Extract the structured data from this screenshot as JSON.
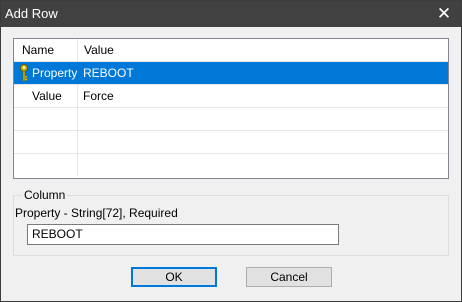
{
  "window": {
    "title": "Add Row",
    "close_glyph": "✕"
  },
  "grid": {
    "columns": [
      "Name",
      "Value"
    ],
    "rows": [
      {
        "name": "Property",
        "value": "REBOOT",
        "selected": true,
        "icon": "key-icon"
      },
      {
        "name": "Value",
        "value": "Force",
        "selected": false
      }
    ]
  },
  "column_group": {
    "legend": "Column",
    "description": "Property - String[72], Required",
    "input_value": "REBOOT"
  },
  "buttons": {
    "ok_label": "OK",
    "cancel_label": "Cancel"
  },
  "colors": {
    "selection": "#0078d7",
    "titlebar": "#414141"
  }
}
